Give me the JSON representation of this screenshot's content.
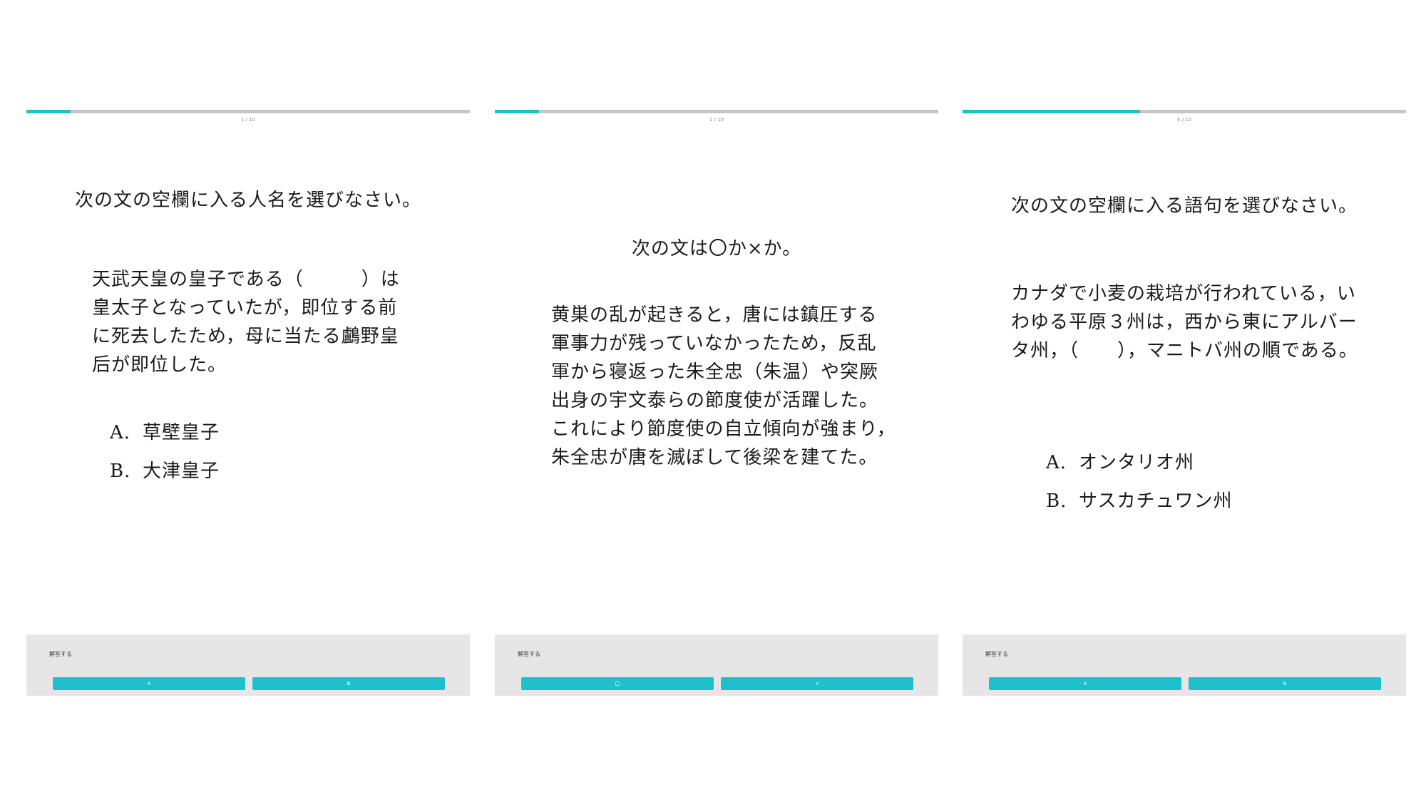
{
  "accent_color": "#1ec0cc",
  "track_color": "#c6c6c6",
  "panels": [
    {
      "counter": "1 / 10",
      "progress": 0.1,
      "instruction": "次の文の空欄に入る人名を選びなさい。",
      "question": "天武天皇の皇子である（　　　）は\n皇太子となっていたが，即位する前\nに死去したため，母に当たる鸕野皇\n后が即位した。",
      "options": [
        {
          "letter": "A.",
          "text": "草壁皇子"
        },
        {
          "letter": "B.",
          "text": "大津皇子"
        }
      ],
      "answer_label": "解答する",
      "buttons": [
        "A",
        "B"
      ]
    },
    {
      "counter": "1 / 10",
      "progress": 0.1,
      "instruction": "次の文は〇か×か。",
      "question": "黄巣の乱が起きると，唐には鎮圧する\n軍事力が残っていなかったため，反乱\n軍から寝返った朱全忠（朱温）や突厥\n出身の宇文泰らの節度使が活躍した。\nこれにより節度使の自立傾向が強まり，\n朱全忠が唐を滅ぼして後梁を建てた。",
      "options": [],
      "answer_label": "解答する",
      "buttons": [
        "〇",
        "×"
      ]
    },
    {
      "counter": "4 / 10",
      "progress": 0.4,
      "instruction": "次の文の空欄に入る語句を選びなさい。",
      "question": "カナダで小麦の栽培が行われている，い\nわゆる平原３州は，西から東にアルバー\nタ州，（　　），マニトバ州の順である。",
      "options": [
        {
          "letter": "A.",
          "text": "オンタリオ州"
        },
        {
          "letter": "B.",
          "text": "サスカチュワン州"
        }
      ],
      "answer_label": "解答する",
      "buttons": [
        "A",
        "B"
      ]
    }
  ]
}
